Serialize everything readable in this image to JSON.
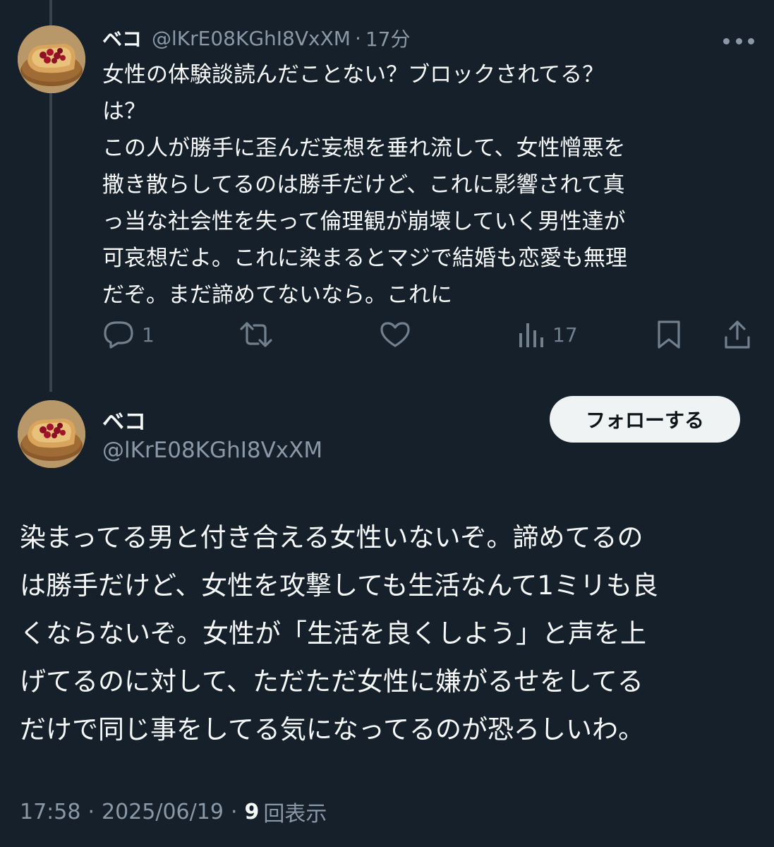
{
  "reply": {
    "name": "ベコ",
    "handle": "@lKrE08KGhI8VxXM",
    "separator": "·",
    "time": "17分",
    "lines": [
      "女性の体験談読んだことない？ブロックされてる？",
      "は？",
      "この人が勝手に歪んだ妄想を垂れ流して、女性憎悪を",
      "撒き散らしてるのは勝手だけど、これに影響されて真",
      "っ当な社会性を失って倫理観が崩壊していく男性達が",
      "可哀想だよ。これに染まるとマジで結婚も恋愛も無理",
      "だぞ。まだ諦めてないなら。これに"
    ],
    "actions": {
      "reply_count": "1",
      "views_count": "17"
    }
  },
  "main": {
    "name": "ベコ",
    "handle": "@lKrE08KGhI8VxXM",
    "follow_label": "フォローする",
    "lines": [
      "染まってる男と付き合える女性いないぞ。諦めてるの",
      "は勝手だけど、女性を攻撃しても生活なんて1ミリも良",
      "くならないぞ。女性が「生活を良くしよう」と声を上",
      "げてるのに対して、ただただ女性に嫌がるせをしてる",
      "だけで同じ事をしてる気になってるのが恐ろしいわ。"
    ],
    "meta": {
      "time": "17:58",
      "separator": "·",
      "date": "2025/06/19",
      "views_number": "9",
      "views_label": "回表示"
    }
  },
  "colors": {
    "background": "#15202b",
    "text": "#f7f9f9",
    "secondary": "#8b98a5",
    "action_icon": "#71808c",
    "follow_bg": "#eff3f4"
  },
  "icons": {
    "reply": "reply-icon",
    "retweet": "retweet-icon",
    "like": "heart-icon",
    "views": "views-chart-icon",
    "bookmark": "bookmark-icon",
    "share": "share-icon",
    "more": "more-dots-icon"
  }
}
